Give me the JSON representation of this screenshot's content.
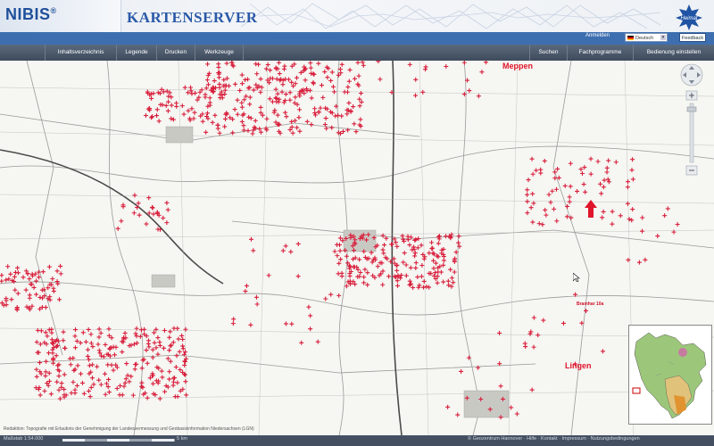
{
  "header": {
    "logo_text": "NIBIS",
    "logo_reg": "®",
    "title": "KARTENSERVER"
  },
  "topbar": {
    "login": "Anmelden",
    "language": "Deutsch",
    "feedback": "Feedback"
  },
  "nav": {
    "left": [
      "Inhaltsverzeichnis",
      "Legende",
      "Drucken",
      "Werkzeuge"
    ],
    "right": [
      "Suchen",
      "Fachprogramme",
      "Bedienung einstellen"
    ]
  },
  "map": {
    "city_labels": [
      "Meppen",
      "Lingen"
    ],
    "annotation": "Bramhar 10a",
    "copyright": "Redaktion: Topografie mit Erlaubnis der Genehmigung der Landesvermessung und Geobasisinformation Niedersachsen (LGN)"
  },
  "status": {
    "scale_text": "Maßstab 1:54.000",
    "scale_label": "5 km",
    "footer_links": [
      "© Geozentrum Hannover",
      "Hilfe",
      "Kontakt",
      "Impressum",
      "Nutzungsbedingungen"
    ]
  },
  "colors": {
    "marker": "#d81f3c",
    "nav_bg": "#4a5768",
    "topbar_bg": "#3d6fb0",
    "logo_blue": "#1e4f9a"
  },
  "icons": [
    "globe-emblem-icon",
    "pan-arrows-icon",
    "zoom-in-icon",
    "zoom-out-icon",
    "zoom-slider-icon",
    "cursor-icon",
    "red-arrow-icon"
  ]
}
